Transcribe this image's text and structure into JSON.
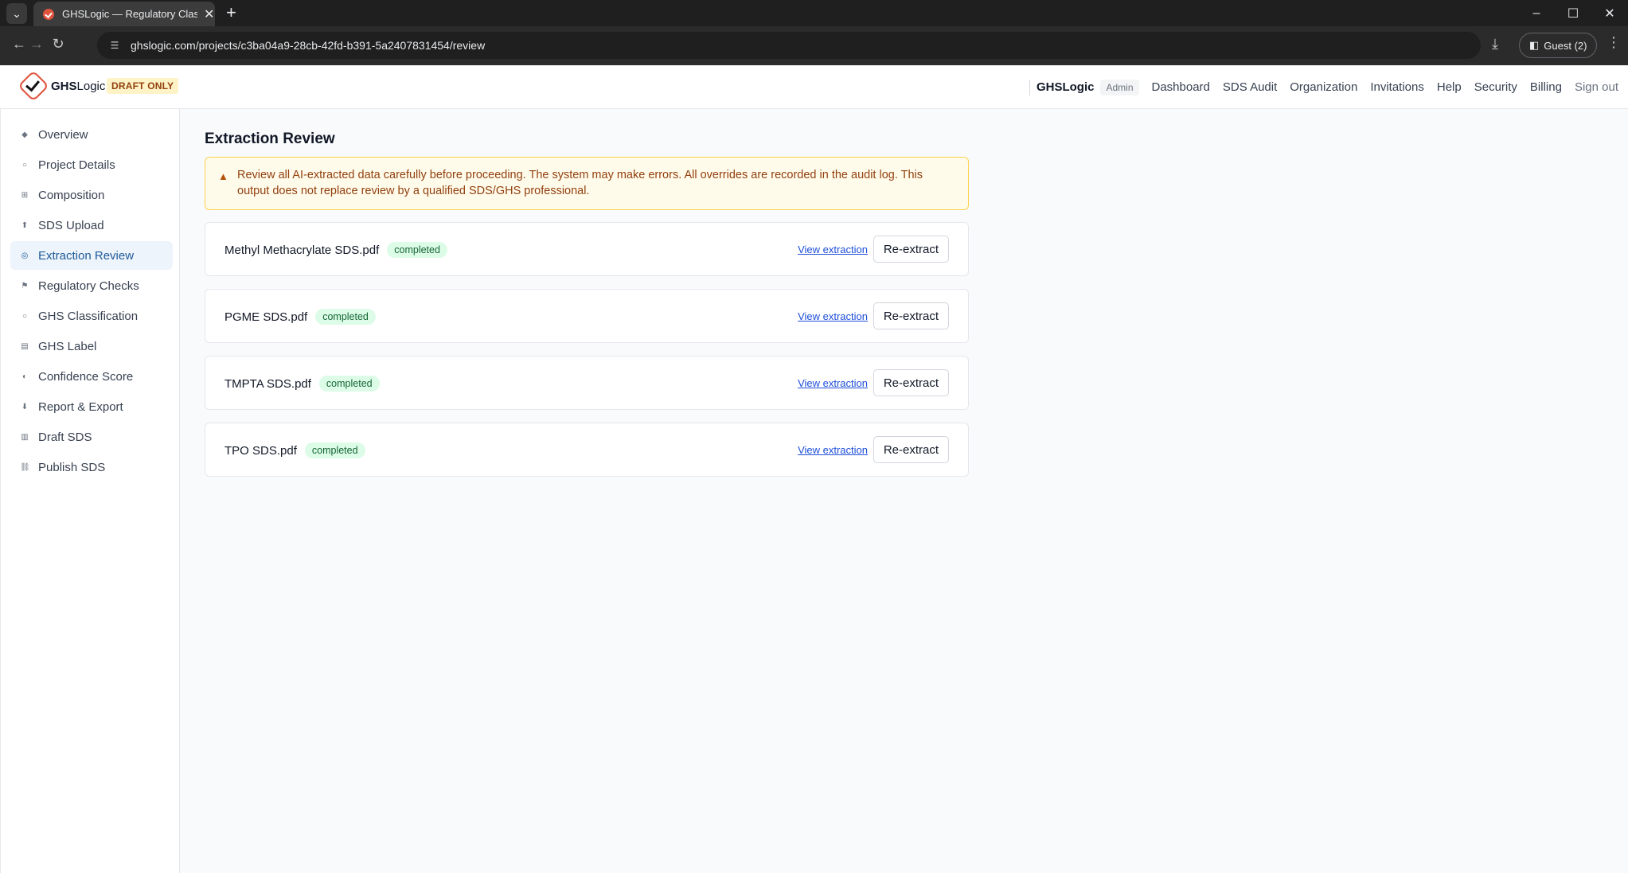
{
  "browser": {
    "tab_title": "GHSLogic — Regulatory Classifi",
    "url": "ghslogic.com/projects/c3ba04a9-28cb-42fd-b391-5a2407831454/review",
    "profile_label": "Guest (2)"
  },
  "header": {
    "brand_bold": "GHS",
    "brand_rest": "Logic",
    "draft_badge": "DRAFT ONLY",
    "org_name": "GHSLogic",
    "role_badge": "Admin",
    "nav": [
      "Dashboard",
      "SDS Audit",
      "Organization",
      "Invitations",
      "Help",
      "Security",
      "Billing",
      "Sign out"
    ]
  },
  "sidebar": {
    "items": [
      {
        "label": "Overview",
        "icon": "diamond-icon",
        "glyph": "◆"
      },
      {
        "label": "Project Details",
        "icon": "circle-icon",
        "glyph": "○"
      },
      {
        "label": "Composition",
        "icon": "grid-icon",
        "glyph": "⊞"
      },
      {
        "label": "SDS Upload",
        "icon": "upload-icon",
        "glyph": "⬆"
      },
      {
        "label": "Extraction Review",
        "icon": "review-icon",
        "glyph": "◎"
      },
      {
        "label": "Regulatory Checks",
        "icon": "flag-icon",
        "glyph": "⚑"
      },
      {
        "label": "GHS Classification",
        "icon": "circle-icon",
        "glyph": "○"
      },
      {
        "label": "GHS Label",
        "icon": "label-icon",
        "glyph": "▤"
      },
      {
        "label": "Confidence Score",
        "icon": "half-circle-icon",
        "glyph": "◐"
      },
      {
        "label": "Report & Export",
        "icon": "export-icon",
        "glyph": "⬇"
      },
      {
        "label": "Draft SDS",
        "icon": "document-icon",
        "glyph": "▥"
      },
      {
        "label": "Publish SDS",
        "icon": "link-icon",
        "glyph": "⛓"
      }
    ],
    "active_index": 4
  },
  "main": {
    "title": "Extraction Review",
    "warning_text": "Review all AI-extracted data carefully before proceeding. The system may make errors. All overrides are recorded in the audit log. This output does not replace review by a qualified SDS/GHS professional.",
    "files": [
      {
        "name": "Methyl Methacrylate SDS.pdf",
        "status": "completed",
        "view_label": "View extraction",
        "action_label": "Re-extract"
      },
      {
        "name": "PGME SDS.pdf",
        "status": "completed",
        "view_label": "View extraction",
        "action_label": "Re-extract"
      },
      {
        "name": "TMPTA SDS.pdf",
        "status": "completed",
        "view_label": "View extraction",
        "action_label": "Re-extract"
      },
      {
        "name": "TPO SDS.pdf",
        "status": "completed",
        "view_label": "View extraction",
        "action_label": "Re-extract"
      }
    ]
  },
  "colors": {
    "accent": "#1e5a99",
    "logo": "#e0533d",
    "warning_bg": "#fffbeb",
    "warning_border": "#fcd34d",
    "status_bg": "#dcfce7",
    "status_text": "#166534"
  }
}
